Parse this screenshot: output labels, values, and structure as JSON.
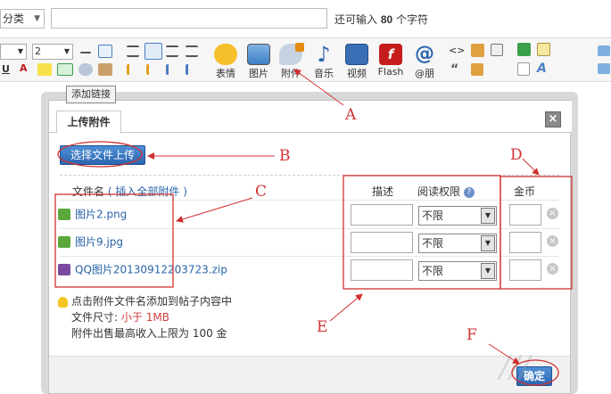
{
  "topbar": {
    "category_label": "分类",
    "title_value": "",
    "remain_prefix": "还可输入",
    "remain_count": "80",
    "remain_suffix": "个字符"
  },
  "toolbar": {
    "font_size_value": "2",
    "buttons": [
      {
        "label": "表情",
        "icon": "smiley-icon"
      },
      {
        "label": "图片",
        "icon": "image-icon"
      },
      {
        "label": "附件",
        "icon": "paperclip-icon"
      },
      {
        "label": "音乐",
        "icon": "music-note-icon"
      },
      {
        "label": "视频",
        "icon": "video-icon"
      },
      {
        "label": "Flash",
        "icon": "flash-icon"
      },
      {
        "label": "@朋",
        "icon": "at-icon"
      }
    ],
    "tooltip": "添加链接"
  },
  "dialog": {
    "tab_label": "上传附件",
    "close_glyph": "×",
    "upload_button": "选择文件上传",
    "col_filename": "文件名",
    "insert_all_link": "插入全部附件",
    "col_desc": "描述",
    "col_permission": "阅读权限",
    "col_gold": "金币",
    "files": [
      {
        "name": "图片2.png",
        "permission": "不限"
      },
      {
        "name": "图片9.jpg",
        "permission": "不限"
      },
      {
        "name": "QQ图片20130912203723.zip",
        "permission": "不限"
      }
    ],
    "notes": {
      "tip": "点击附件文件名添加到帖子内容中",
      "size_prefix": "文件尺寸:",
      "size_value": "小于 1MB",
      "sale_limit": "附件出售最高收入上限为 100 金"
    },
    "ok_button": "确定"
  },
  "annotations": [
    "A",
    "B",
    "C",
    "D",
    "E",
    "F"
  ],
  "colors": {
    "annotation_red": "#d23030",
    "link_blue": "#2a64a8",
    "button_blue": "#2c66b0"
  }
}
